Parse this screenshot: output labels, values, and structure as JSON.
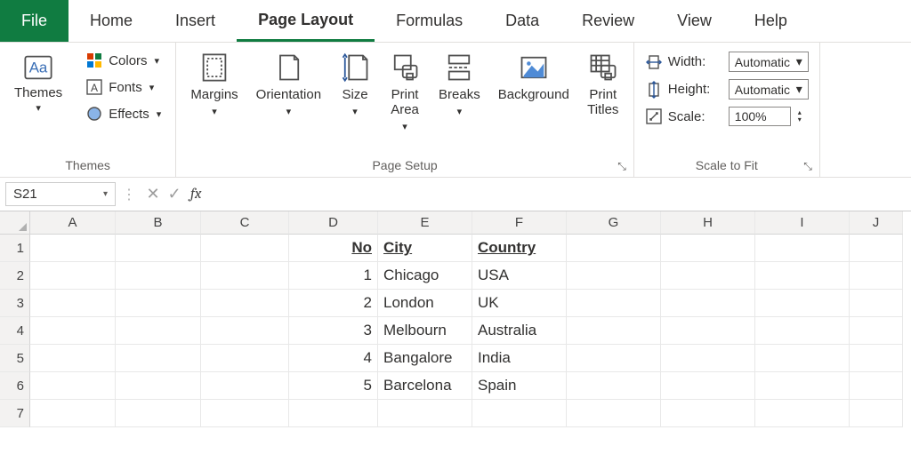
{
  "tabs": {
    "file": "File",
    "home": "Home",
    "insert": "Insert",
    "page_layout": "Page Layout",
    "formulas": "Formulas",
    "data": "Data",
    "review": "Review",
    "view": "View",
    "help": "Help"
  },
  "ribbon": {
    "themes": {
      "themes": "Themes",
      "colors": "Colors",
      "fonts": "Fonts",
      "effects": "Effects",
      "group": "Themes"
    },
    "page_setup": {
      "margins": "Margins",
      "orientation": "Orientation",
      "size": "Size",
      "print_area": "Print",
      "print_area2": "Area",
      "breaks": "Breaks",
      "background": "Background",
      "print_titles": "Print",
      "print_titles2": "Titles",
      "group": "Page Setup"
    },
    "scale": {
      "width": "Width:",
      "height": "Height:",
      "scale": "Scale:",
      "auto": "Automatic",
      "auto2": "Automatic",
      "pct": "100%",
      "group": "Scale to Fit"
    }
  },
  "formula_bar": {
    "namebox": "S21",
    "fx": "fx",
    "value": ""
  },
  "grid": {
    "columns": [
      "A",
      "B",
      "C",
      "D",
      "E",
      "F",
      "G",
      "H",
      "I",
      "J"
    ],
    "rows": [
      "1",
      "2",
      "3",
      "4",
      "5",
      "6",
      "7"
    ],
    "headers": {
      "no": "No",
      "city": "City",
      "country": "Country"
    },
    "data": [
      {
        "no": "1",
        "city": "Chicago",
        "country": "USA"
      },
      {
        "no": "2",
        "city": "London",
        "country": "UK"
      },
      {
        "no": "3",
        "city": "Melbourn",
        "country": "Australia"
      },
      {
        "no": "4",
        "city": "Bangalore",
        "country": "India"
      },
      {
        "no": "5",
        "city": "Barcelona",
        "country": "Spain"
      }
    ]
  }
}
